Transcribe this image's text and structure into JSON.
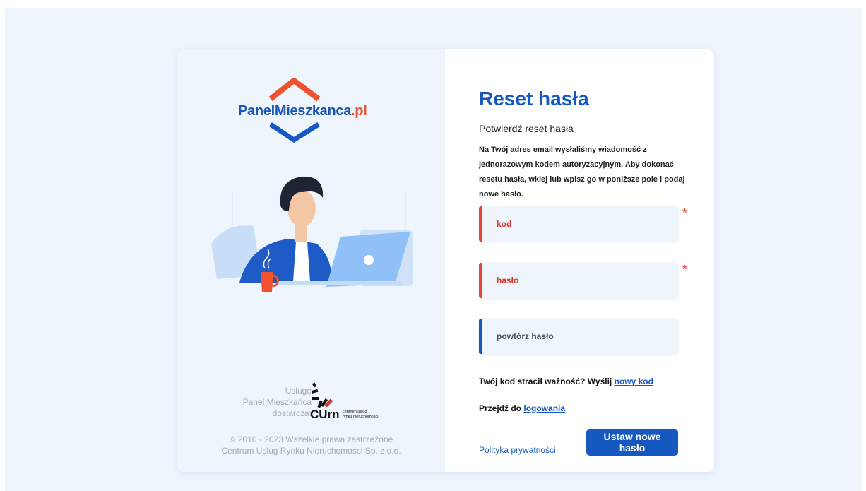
{
  "brand": {
    "logo_main": "PanelMieszkanca",
    "logo_suffix": ".pl"
  },
  "provider": {
    "label_line1": "Usługę",
    "label_line2": "Panel Mieszkańca",
    "label_line3": "dostarcza:",
    "curn_logo_text": "CUrn",
    "curn_sub_line1": "centrum usług",
    "curn_sub_line2": "rynku nieruchomości"
  },
  "copyright": {
    "line1": "© 2010 - 2023 Wszelkie prawa zastrzeżone",
    "line2": "Centrum Usług Rynku Nieruchomości Sp. z o.o."
  },
  "form": {
    "title": "Reset hasła",
    "subtitle": "Potwierdź reset hasła",
    "description": "Na Twój adres email wysłaliśmy wiadomość z jednorazowym kodem autoryzacyjnym. Aby dokonać resetu hasła, wklej lub wpisz go w poniższe pole i podaj nowe hasło.",
    "fields": {
      "code": {
        "value": "",
        "placeholder": "kod",
        "required_mark": "*"
      },
      "password": {
        "value": "",
        "placeholder": "hasło",
        "required_mark": "*"
      },
      "repeat_password": {
        "value": "",
        "placeholder": "powtórz hasło"
      }
    },
    "resend_text": "Twój kod stracił ważność? Wyślij",
    "resend_link": "nowy kod",
    "login_text": "Przejdź do",
    "login_link": "logowania",
    "privacy_link": "Polityka prywatności",
    "submit_label": "Ustaw nowe hasło"
  },
  "colors": {
    "accent_blue": "#1558c0",
    "brand_orange": "#f0522e",
    "error_red": "#e8443a",
    "panel_bg": "#eef5fd"
  }
}
